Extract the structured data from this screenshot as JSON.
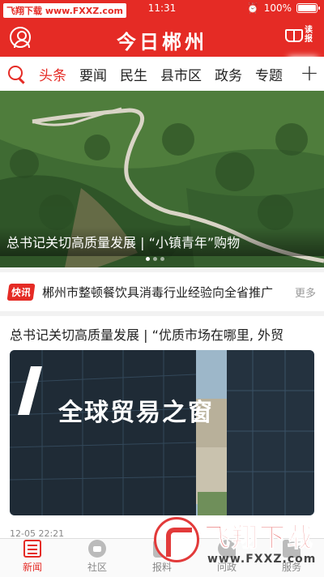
{
  "status_bar": {
    "time": "11:31",
    "battery": "100%",
    "watermark_badge": "飞翔下载 www.FXXZ.com"
  },
  "header": {
    "title": "今日郴州",
    "read_label": "读报"
  },
  "tabs": [
    "头条",
    "要闻",
    "民生",
    "县市区",
    "政务",
    "专题"
  ],
  "hero": {
    "caption": "总书记关切高质量发展 | “小镇青年”购物"
  },
  "flash": {
    "badge": "快讯",
    "text": "郴州市整顿餐饮具消毒行业经验向全省推广",
    "more": "更多"
  },
  "article": {
    "headline": "总书记关切高质量发展 | “优质市场在哪里, 外贸",
    "sign_text": "全球贸易之窗",
    "date": "12-05 22:21"
  },
  "bottom_nav": [
    "新闻",
    "社区",
    "报料",
    "问政",
    "服务"
  ],
  "watermark": {
    "title": "飞翔下载",
    "url": "www.FXXZ.com"
  },
  "colors": {
    "brand": "#e52b25"
  }
}
